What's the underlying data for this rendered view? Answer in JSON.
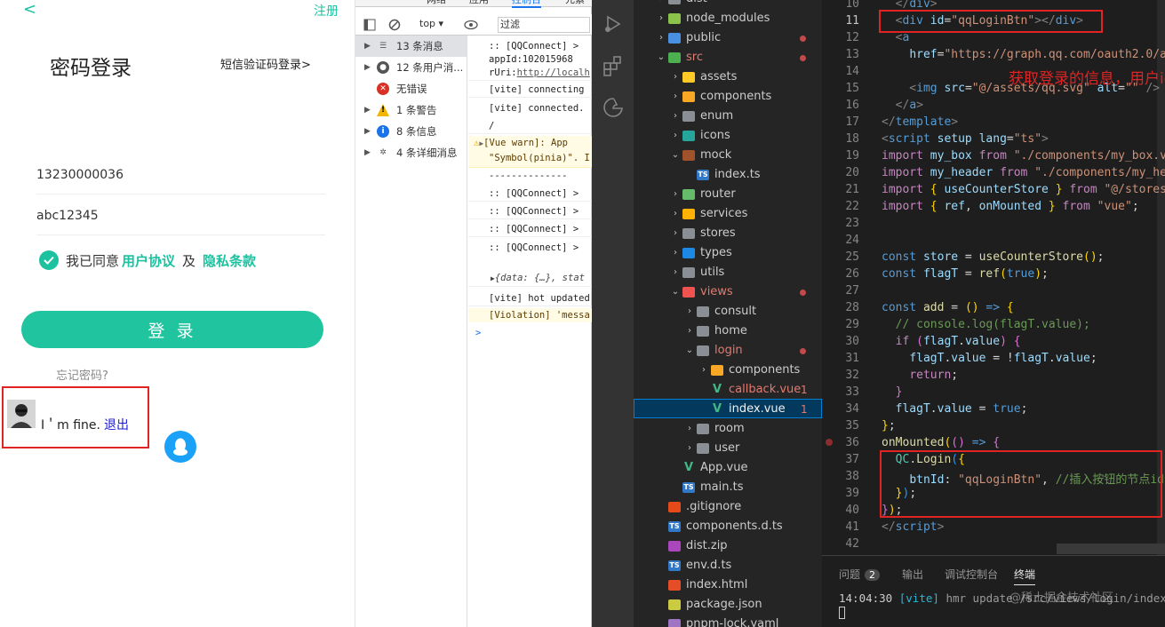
{
  "mobile": {
    "back_glyph": "<",
    "register": "注册",
    "title": "密码登录",
    "sms_link": "短信验证码登录>",
    "phone_value": "13230000036",
    "password_value": "abc12345",
    "agree_prefix": "我已同意",
    "user_agreement": "用户协议",
    "and": "及",
    "privacy": "隐私条款",
    "login_button": "登 录",
    "forgot": "忘记密码?",
    "user_name": "I＇m fine.",
    "logout": "退出",
    "accent": "#1cc19f"
  },
  "devtools": {
    "tabs": [
      "网络",
      "应用",
      "控制台",
      "元素"
    ],
    "active_tab": "控制台",
    "context": "top ▾",
    "filter_placeholder": "过滤",
    "sidebar": [
      {
        "label": "13 条消息",
        "icon": "list-icon"
      },
      {
        "label": "12 条用户消...",
        "icon": "user-icon"
      },
      {
        "label": "无错误",
        "icon": "error-icon"
      },
      {
        "label": "1 条警告",
        "icon": "warning-icon"
      },
      {
        "label": "8 条信息",
        "icon": "info-icon"
      },
      {
        "label": "4 条详细消息",
        "icon": "gear-icon"
      }
    ],
    "lines": [
      ":: [QQConnect] >",
      "appId:102015968",
      "rUri:",
      "http://localh",
      "[vite] connecting",
      "[vite] connected.",
      "/",
      "[Vue warn]: App",
      "\"Symbol(pinia)\". I",
      "--------------",
      ":: [QQConnect] >",
      ":: [QQConnect] >",
      ":: [QQConnect] >",
      ":: [QQConnect] >",
      "{data: {…}, stat",
      "[vite] hot updated",
      "[Violation] 'messa",
      ">"
    ]
  },
  "explorer": {
    "items": [
      {
        "label": "dist",
        "depth": 1,
        "caret": "›",
        "icon": "folder-icon"
      },
      {
        "label": "node_modules",
        "depth": 1,
        "caret": "›",
        "icon": "node-folder-icon"
      },
      {
        "label": "public",
        "depth": 1,
        "caret": "›",
        "icon": "public-folder-icon"
      },
      {
        "label": "src",
        "depth": 1,
        "caret": "⌄",
        "icon": "src-folder-icon"
      },
      {
        "label": "assets",
        "depth": 2,
        "caret": "›",
        "icon": "assets-folder-icon"
      },
      {
        "label": "components",
        "depth": 2,
        "caret": "›",
        "icon": "components-folder-icon"
      },
      {
        "label": "enum",
        "depth": 2,
        "caret": "›",
        "icon": "folder-icon"
      },
      {
        "label": "icons",
        "depth": 2,
        "caret": "›",
        "icon": "icons-folder-icon"
      },
      {
        "label": "mock",
        "depth": 2,
        "caret": "⌄",
        "icon": "mock-folder-icon"
      },
      {
        "label": "index.ts",
        "depth": 3,
        "caret": "",
        "icon": "ts-file-icon"
      },
      {
        "label": "router",
        "depth": 2,
        "caret": "›",
        "icon": "router-folder-icon"
      },
      {
        "label": "services",
        "depth": 2,
        "caret": "›",
        "icon": "services-folder-icon"
      },
      {
        "label": "stores",
        "depth": 2,
        "caret": "›",
        "icon": "folder-icon"
      },
      {
        "label": "types",
        "depth": 2,
        "caret": "›",
        "icon": "types-folder-icon"
      },
      {
        "label": "utils",
        "depth": 2,
        "caret": "›",
        "icon": "folder-icon"
      },
      {
        "label": "views",
        "depth": 2,
        "caret": "⌄",
        "icon": "views-folder-icon"
      },
      {
        "label": "consult",
        "depth": 3,
        "caret": "›",
        "icon": "folder-icon"
      },
      {
        "label": "home",
        "depth": 3,
        "caret": "›",
        "icon": "folder-icon"
      },
      {
        "label": "login",
        "depth": 3,
        "caret": "⌄",
        "icon": "folder-open-icon"
      },
      {
        "label": "components",
        "depth": 4,
        "caret": "›",
        "icon": "components-folder-icon"
      },
      {
        "label": "callback.vue",
        "depth": 4,
        "caret": "",
        "icon": "vue-file-icon",
        "badge": "1"
      },
      {
        "label": "index.vue",
        "depth": 4,
        "caret": "",
        "icon": "vue-file-icon",
        "badge": "1"
      },
      {
        "label": "room",
        "depth": 3,
        "caret": "›",
        "icon": "folder-icon"
      },
      {
        "label": "user",
        "depth": 3,
        "caret": "›",
        "icon": "folder-icon"
      },
      {
        "label": "App.vue",
        "depth": 2,
        "caret": "",
        "icon": "vue-file-icon"
      },
      {
        "label": "main.ts",
        "depth": 2,
        "caret": "",
        "icon": "ts-file-icon"
      },
      {
        "label": ".gitignore",
        "depth": 1,
        "caret": "",
        "icon": "git-file-icon"
      },
      {
        "label": "components.d.ts",
        "depth": 1,
        "caret": "",
        "icon": "ts-file-icon"
      },
      {
        "label": "dist.zip",
        "depth": 1,
        "caret": "",
        "icon": "zip-file-icon"
      },
      {
        "label": "env.d.ts",
        "depth": 1,
        "caret": "",
        "icon": "ts-file-icon"
      },
      {
        "label": "index.html",
        "depth": 1,
        "caret": "",
        "icon": "html-file-icon"
      },
      {
        "label": "package.json",
        "depth": 1,
        "caret": "",
        "icon": "json-file-icon"
      },
      {
        "label": "pnpm-lock.yaml",
        "depth": 1,
        "caret": "",
        "icon": "yaml-file-icon"
      }
    ]
  },
  "editor": {
    "line_numbers": [
      "10",
      "11",
      "12",
      "13",
      "14",
      "15",
      "16",
      "17",
      "18",
      "19",
      "20",
      "21",
      "22",
      "23",
      "24",
      "25",
      "26",
      "27",
      "28",
      "29",
      "30",
      "31",
      "32",
      "33",
      "34",
      "35",
      "36",
      "37",
      "38",
      "39",
      "40",
      "41",
      "42"
    ],
    "annotation": "获取登录的信息，用户id 头像"
  },
  "panel": {
    "tabs": [
      "问题",
      "输出",
      "调试控制台",
      "终端"
    ],
    "problems_count": "2",
    "active_tab": "终端",
    "terminal_time": "14:04:30",
    "terminal_tag": "[vite]",
    "terminal_msg": "hmr update",
    "terminal_path": "/src/views/login/index.vue",
    "watermark": "@稀土掘金技术社区"
  }
}
